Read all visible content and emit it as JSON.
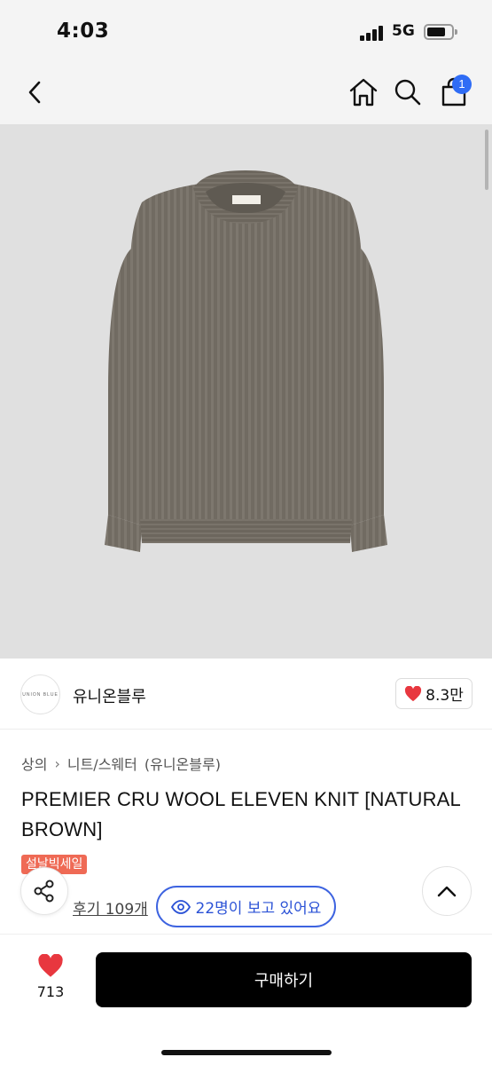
{
  "status_bar": {
    "time": "4:03",
    "network": "5G"
  },
  "nav": {
    "cart_count": "1",
    "icons": [
      "back-arrow-icon",
      "home-icon",
      "search-icon",
      "shopping-bag-icon"
    ]
  },
  "product_image": {
    "subject": "grey-brown ribbed crew neck knit sweater"
  },
  "brand": {
    "logo_text": "UNION BLUE",
    "name": "유니온블루",
    "like_count": "8.3만"
  },
  "breadcrumb": {
    "category": "상의",
    "subcategory": "니트/스웨터",
    "brand": "(유니온블루)"
  },
  "product": {
    "title": "PREMIER CRU WOOL ELEVEN KNIT [NATURAL BROWN]",
    "sale_badge": "설날빅세일",
    "review_label": "후기 109개",
    "viewers_text": "22명이 보고 있어요"
  },
  "bottom_bar": {
    "wish_count": "713",
    "buy_label": "구매하기"
  },
  "colors": {
    "accent_blue": "#3d63e0",
    "badge_blue": "#2f6cf5",
    "sale_red": "#ef6a55",
    "heart_red": "#e8373f",
    "buy_button": "#000000"
  }
}
